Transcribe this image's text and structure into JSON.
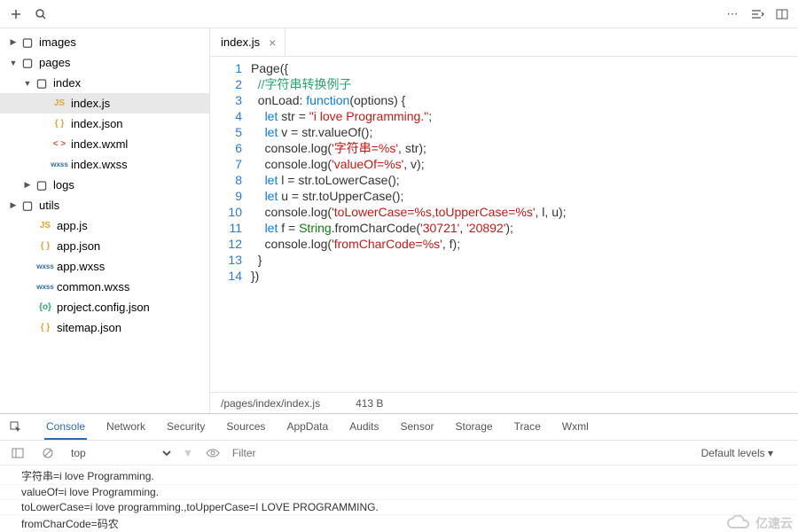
{
  "toolbar": {},
  "tree": [
    {
      "pad": 10,
      "chev": "▶",
      "icon": "folder",
      "label": "images"
    },
    {
      "pad": 10,
      "chev": "▼",
      "icon": "folder",
      "label": "pages"
    },
    {
      "pad": 26,
      "chev": "▼",
      "icon": "folder",
      "label": "index"
    },
    {
      "pad": 46,
      "chev": "",
      "icon": "js",
      "label": "index.js",
      "sel": true
    },
    {
      "pad": 46,
      "chev": "",
      "icon": "json",
      "label": "index.json"
    },
    {
      "pad": 46,
      "chev": "",
      "icon": "wxml",
      "label": "index.wxml"
    },
    {
      "pad": 46,
      "chev": "",
      "icon": "wxss",
      "label": "index.wxss"
    },
    {
      "pad": 26,
      "chev": "▶",
      "icon": "folder",
      "label": "logs"
    },
    {
      "pad": 10,
      "chev": "▶",
      "icon": "folder",
      "label": "utils"
    },
    {
      "pad": 30,
      "chev": "",
      "icon": "js",
      "label": "app.js"
    },
    {
      "pad": 30,
      "chev": "",
      "icon": "json",
      "label": "app.json"
    },
    {
      "pad": 30,
      "chev": "",
      "icon": "wxss",
      "label": "app.wxss"
    },
    {
      "pad": 30,
      "chev": "",
      "icon": "wxss",
      "label": "common.wxss"
    },
    {
      "pad": 30,
      "chev": "",
      "icon": "cfg",
      "label": "project.config.json"
    },
    {
      "pad": 30,
      "chev": "",
      "icon": "json",
      "label": "sitemap.json"
    }
  ],
  "tab": {
    "name": "index.js"
  },
  "lines": [
    "1",
    "2",
    "3",
    "4",
    "5",
    "6",
    "7",
    "8",
    "9",
    "10",
    "11",
    "12",
    "13",
    "14"
  ],
  "status": {
    "path": "/pages/index/index.js",
    "size": "413 B"
  },
  "devtabs": [
    "Console",
    "Network",
    "Security",
    "Sources",
    "AppData",
    "Audits",
    "Sensor",
    "Storage",
    "Trace",
    "Wxml"
  ],
  "console": {
    "top": "top",
    "filter_ph": "Filter",
    "levels": "Default levels ▾",
    "logs": [
      "字符串=i love Programming.",
      "valueOf=i love Programming.",
      "toLowerCase=i love programming.,toUpperCase=I LOVE PROGRAMMING.",
      "fromCharCode=码农"
    ]
  },
  "watermark": "亿速云",
  "code_text": {
    "comment": "//字符串转换例子",
    "str_lit": "\"i love Programming.\"",
    "s1": "'字符串=%s'",
    "s2": "'valueOf=%s'",
    "s3": "'toLowerCase=%s,toUpperCase=%s'",
    "s4": "'30721'",
    "s5": "'20892'",
    "s6": "'fromCharCode=%s'"
  }
}
